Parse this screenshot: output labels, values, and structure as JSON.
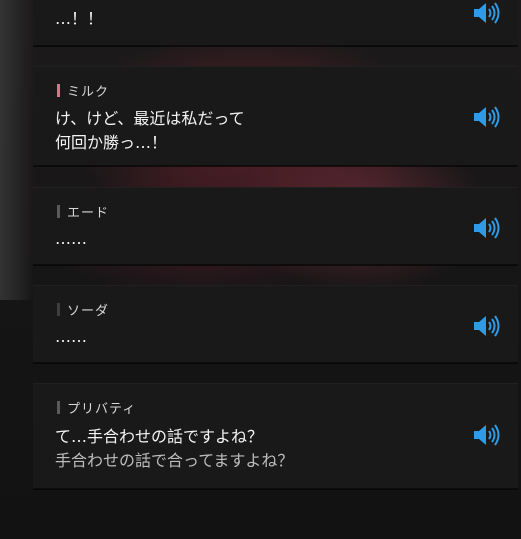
{
  "colors": {
    "accent_milk": "#e0718a",
    "accent_default": "#5a5a5a",
    "voice_icon": "#2f9be6"
  },
  "entries": [
    {
      "speaker": "",
      "lines": [
        "…！！"
      ],
      "icon": "speaker-voice-icon"
    },
    {
      "speaker": "ミルク",
      "lines": [
        "け、けど、最近は私だって",
        "何回か勝っ…！"
      ],
      "icon": "speaker-voice-icon"
    },
    {
      "speaker": "エード",
      "lines": [
        "……"
      ],
      "icon": "speaker-voice-icon"
    },
    {
      "speaker": "ソーダ",
      "lines": [
        "……"
      ],
      "icon": "speaker-voice-icon"
    },
    {
      "speaker": "プリバティ",
      "lines": [
        "て…手合わせの話ですよね？",
        "手合わせの話で合ってますよね？"
      ],
      "icon": "speaker-voice-icon"
    }
  ]
}
